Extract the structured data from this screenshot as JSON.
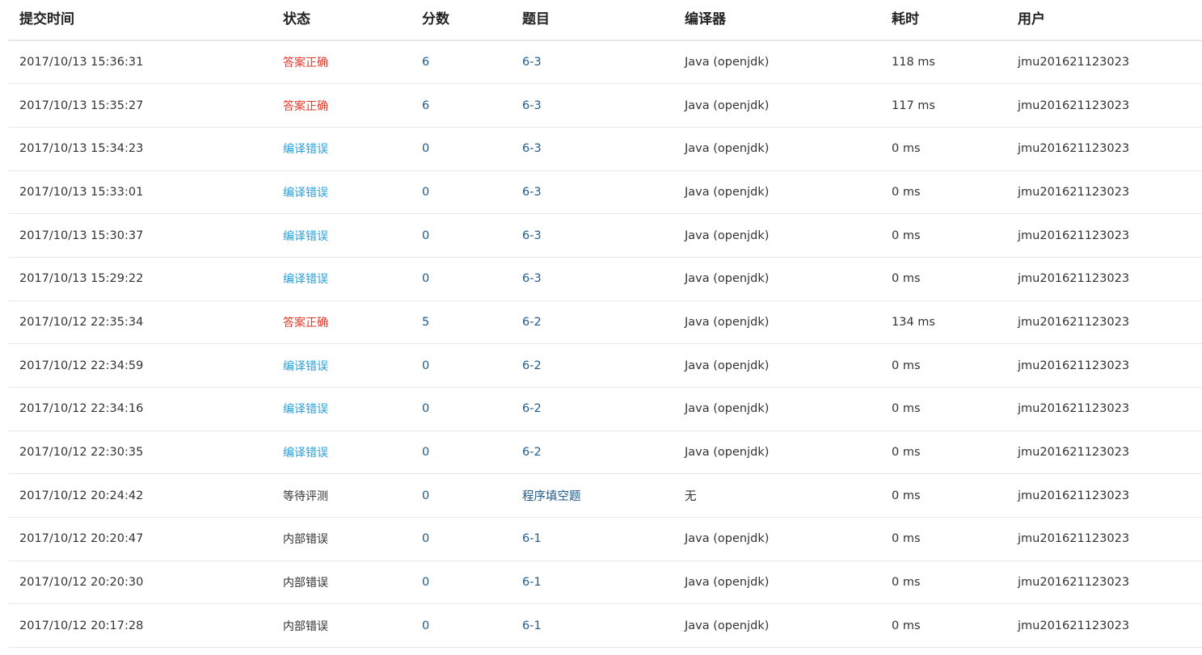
{
  "colors": {
    "accepted": "#e0392b",
    "compile_error": "#2a9fd6",
    "link": "#1f5a8e",
    "text": "#333333",
    "border": "#e8e8e8"
  },
  "table": {
    "headers": {
      "submit_time": "提交时间",
      "status": "状态",
      "score": "分数",
      "problem": "题目",
      "compiler": "编译器",
      "time_cost": "耗时",
      "user": "用户"
    },
    "rows": [
      {
        "submit_time": "2017/10/13 15:36:31",
        "status": "答案正确",
        "status_type": "accepted",
        "score": "6",
        "problem": "6-3",
        "compiler": "Java (openjdk)",
        "time_cost": "118 ms",
        "user": "jmu201621123023"
      },
      {
        "submit_time": "2017/10/13 15:35:27",
        "status": "答案正确",
        "status_type": "accepted",
        "score": "6",
        "problem": "6-3",
        "compiler": "Java (openjdk)",
        "time_cost": "117 ms",
        "user": "jmu201621123023"
      },
      {
        "submit_time": "2017/10/13 15:34:23",
        "status": "编译错误",
        "status_type": "compile-error",
        "score": "0",
        "problem": "6-3",
        "compiler": "Java (openjdk)",
        "time_cost": "0 ms",
        "user": "jmu201621123023"
      },
      {
        "submit_time": "2017/10/13 15:33:01",
        "status": "编译错误",
        "status_type": "compile-error",
        "score": "0",
        "problem": "6-3",
        "compiler": "Java (openjdk)",
        "time_cost": "0 ms",
        "user": "jmu201621123023"
      },
      {
        "submit_time": "2017/10/13 15:30:37",
        "status": "编译错误",
        "status_type": "compile-error",
        "score": "0",
        "problem": "6-3",
        "compiler": "Java (openjdk)",
        "time_cost": "0 ms",
        "user": "jmu201621123023"
      },
      {
        "submit_time": "2017/10/13 15:29:22",
        "status": "编译错误",
        "status_type": "compile-error",
        "score": "0",
        "problem": "6-3",
        "compiler": "Java (openjdk)",
        "time_cost": "0 ms",
        "user": "jmu201621123023"
      },
      {
        "submit_time": "2017/10/12 22:35:34",
        "status": "答案正确",
        "status_type": "accepted",
        "score": "5",
        "problem": "6-2",
        "compiler": "Java (openjdk)",
        "time_cost": "134 ms",
        "user": "jmu201621123023"
      },
      {
        "submit_time": "2017/10/12 22:34:59",
        "status": "编译错误",
        "status_type": "compile-error",
        "score": "0",
        "problem": "6-2",
        "compiler": "Java (openjdk)",
        "time_cost": "0 ms",
        "user": "jmu201621123023"
      },
      {
        "submit_time": "2017/10/12 22:34:16",
        "status": "编译错误",
        "status_type": "compile-error",
        "score": "0",
        "problem": "6-2",
        "compiler": "Java (openjdk)",
        "time_cost": "0 ms",
        "user": "jmu201621123023"
      },
      {
        "submit_time": "2017/10/12 22:30:35",
        "status": "编译错误",
        "status_type": "compile-error",
        "score": "0",
        "problem": "6-2",
        "compiler": "Java (openjdk)",
        "time_cost": "0 ms",
        "user": "jmu201621123023"
      },
      {
        "submit_time": "2017/10/12 20:24:42",
        "status": "等待评测",
        "status_type": "pending",
        "score": "0",
        "problem": "程序填空题",
        "compiler": "无",
        "time_cost": "0 ms",
        "user": "jmu201621123023"
      },
      {
        "submit_time": "2017/10/12 20:20:47",
        "status": "内部错误",
        "status_type": "internal-error",
        "score": "0",
        "problem": "6-1",
        "compiler": "Java (openjdk)",
        "time_cost": "0 ms",
        "user": "jmu201621123023"
      },
      {
        "submit_time": "2017/10/12 20:20:30",
        "status": "内部错误",
        "status_type": "internal-error",
        "score": "0",
        "problem": "6-1",
        "compiler": "Java (openjdk)",
        "time_cost": "0 ms",
        "user": "jmu201621123023"
      },
      {
        "submit_time": "2017/10/12 20:17:28",
        "status": "内部错误",
        "status_type": "internal-error",
        "score": "0",
        "problem": "6-1",
        "compiler": "Java (openjdk)",
        "time_cost": "0 ms",
        "user": "jmu201621123023"
      }
    ]
  }
}
